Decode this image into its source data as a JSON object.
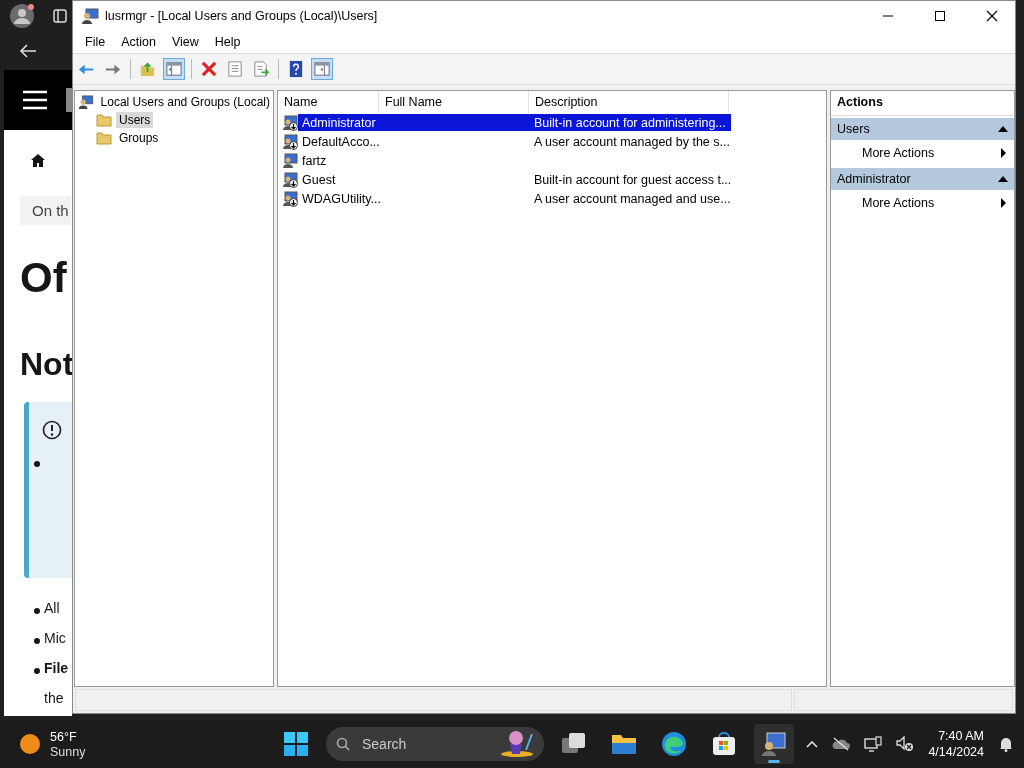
{
  "browser": {
    "texts": [
      {
        "kind": "crumb",
        "text": "On th"
      },
      {
        "kind": "h1",
        "text": "Of"
      },
      {
        "kind": "h2",
        "text": "Not"
      },
      {
        "kind": "bullet",
        "text": "All"
      },
      {
        "kind": "bullet",
        "text": "Mic"
      },
      {
        "kind": "bullet-bold",
        "text": "File"
      },
      {
        "kind": "cont",
        "text": "the"
      }
    ]
  },
  "window": {
    "title": "lusrmgr - [Local Users and Groups (Local)\\Users]",
    "menu": [
      "File",
      "Action",
      "View",
      "Help"
    ],
    "toolbar": [
      {
        "kind": "back",
        "on": false
      },
      {
        "kind": "forward",
        "on": false
      },
      {
        "kind": "sep"
      },
      {
        "kind": "up",
        "on": false
      },
      {
        "kind": "tree",
        "on": true
      },
      {
        "kind": "sep"
      },
      {
        "kind": "delete",
        "on": false
      },
      {
        "kind": "properties",
        "on": false
      },
      {
        "kind": "export",
        "on": false
      },
      {
        "kind": "sep"
      },
      {
        "kind": "help",
        "on": false
      },
      {
        "kind": "actionpane",
        "on": true
      }
    ],
    "tree": {
      "label": "Local Users and Groups (Local)",
      "children": [
        {
          "label": "Users",
          "selected": true
        },
        {
          "label": "Groups",
          "selected": false
        }
      ]
    },
    "columns": [
      "Name",
      "Full Name",
      "Description"
    ],
    "rows": [
      {
        "name": "Administrator",
        "description": "Built-in account for administering...",
        "selected": true,
        "disabled": true
      },
      {
        "name": "DefaultAcco...",
        "description": "A user account managed by the s...",
        "selected": false,
        "disabled": true
      },
      {
        "name": "fartz",
        "selected": false,
        "disabled": false
      },
      {
        "name": "Guest",
        "description": "Built-in account for guest access t...",
        "selected": false,
        "disabled": true
      },
      {
        "name": "WDAGUtility...",
        "description": "A user account managed and use...",
        "selected": false,
        "disabled": true
      }
    ],
    "actions": {
      "title": "Actions",
      "groups": [
        {
          "label": "Users",
          "expanded": true,
          "items": [
            "More Actions"
          ]
        },
        {
          "label": "Administrator",
          "expanded": true,
          "items": [
            "More Actions"
          ]
        }
      ]
    }
  },
  "taskbar": {
    "weather": {
      "temp": "56°F",
      "condition": "Sunny"
    },
    "search": {
      "placeholder": "Search"
    },
    "apps": [
      {
        "kind": "start",
        "selected": false
      },
      {
        "kind": "taskview",
        "selected": false
      },
      {
        "kind": "explorer",
        "selected": false
      },
      {
        "kind": "edge",
        "selected": false
      },
      {
        "kind": "store",
        "selected": false
      },
      {
        "kind": "mmc",
        "selected": true
      }
    ],
    "time": "7:40 AM",
    "date": "4/14/2024"
  }
}
